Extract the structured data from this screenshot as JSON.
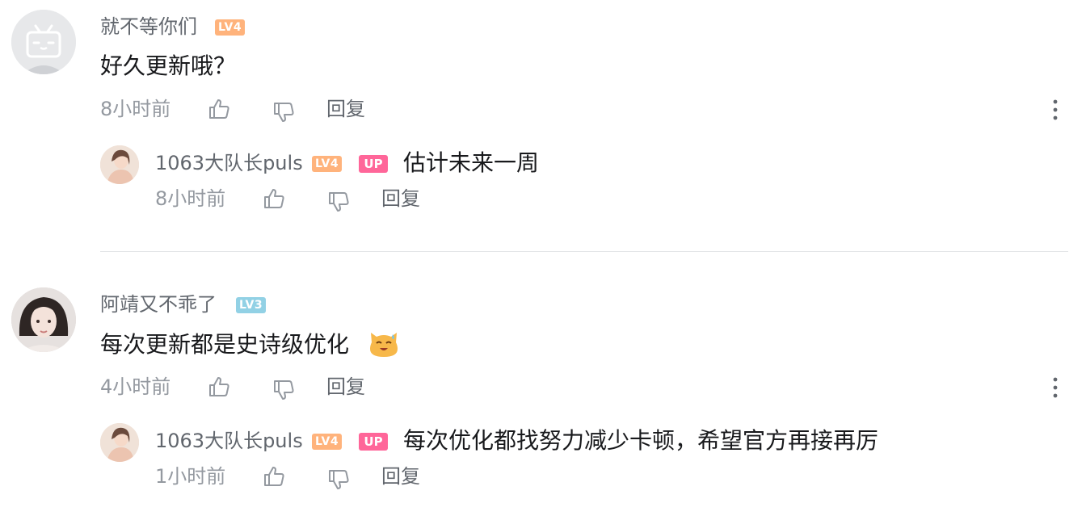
{
  "comments": [
    {
      "username": "就不等你们",
      "level": "LV4",
      "content": "好久更新哦？",
      "time": "8小时前",
      "reply_label": "回复",
      "reply": {
        "username": "1063大队长puls",
        "level": "LV4",
        "badge": "UP",
        "content": "估计未来一周",
        "time": "8小时前",
        "reply_label": "回复"
      }
    },
    {
      "username": "阿靖又不乖了",
      "level": "LV3",
      "content": "每次更新都是史诗级优化",
      "emoji": "sweat-smile-emoji",
      "time": "4小时前",
      "reply_label": "回复",
      "reply": {
        "username": "1063大队长puls",
        "level": "LV4",
        "badge": "UP",
        "content": "每次优化都找努力减少卡顿，希望官方再接再厉",
        "time": "1小时前",
        "reply_label": "回复"
      }
    }
  ],
  "colors": {
    "level4": "#ffb37c",
    "level3": "#92d1e5",
    "up_badge": "#ff6699",
    "muted_text": "#9499a0",
    "name_text": "#61666d"
  }
}
